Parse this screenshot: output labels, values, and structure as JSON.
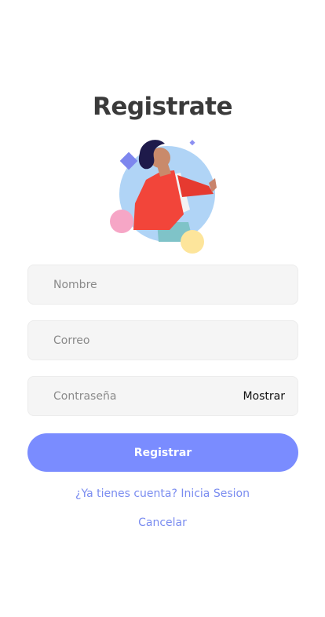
{
  "header": {
    "title": "Registrate"
  },
  "illustration": {
    "icon": "person-illustration-icon"
  },
  "form": {
    "name": {
      "placeholder": "Nombre",
      "value": ""
    },
    "email": {
      "placeholder": "Correo",
      "value": ""
    },
    "password": {
      "placeholder": "Contraseña",
      "value": "",
      "toggle_label": "Mostrar"
    }
  },
  "actions": {
    "register_label": "Registrar",
    "login_link": "¿Ya tienes cuenta? Inicia Sesion",
    "cancel_link": "Cancelar"
  },
  "colors": {
    "accent": "#7a8cff",
    "link": "#7a8cf0",
    "field_bg": "#f5f5f5",
    "title": "#3a3a3a"
  }
}
